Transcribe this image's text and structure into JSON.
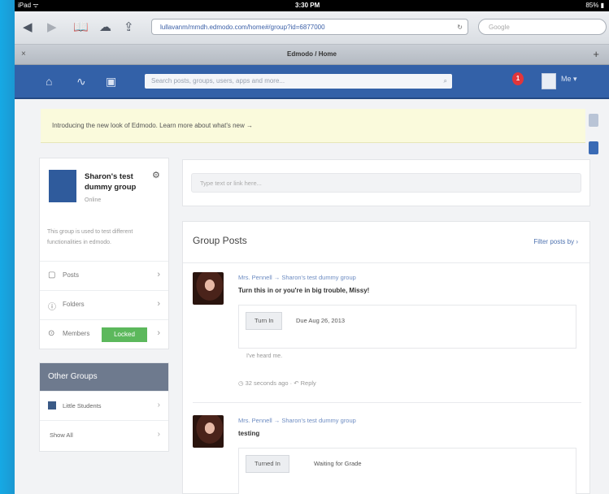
{
  "status": {
    "left": "iPad ᯤ",
    "time": "3:30 PM",
    "battery": "85% ▮"
  },
  "browser": {
    "url": "lullavanm/mmdh.edmodo.com/home#/group?id=6877000",
    "search_placeholder": "Google",
    "tab_title": "Edmodo / Home",
    "tab_close": "×",
    "tab_add": "+"
  },
  "appnav": {
    "search_placeholder": "Search posts, groups, users, apps and more...",
    "notif_count": "1",
    "me_label": "Me ▾"
  },
  "notice": {
    "text": "Introducing the new look of Edmodo. Learn more about what's new →",
    "close": "×"
  },
  "group": {
    "name": "Sharon's test dummy group",
    "subtitle": "Online",
    "description": "This group is used to test different functionalities in edmodo.",
    "rows": [
      {
        "icon": "folder-icon",
        "glyph": "▢",
        "label": "Posts",
        "arrow": "›"
      },
      {
        "icon": "info-icon",
        "glyph": "ⓘ",
        "label": "Folders",
        "arrow": "›"
      },
      {
        "icon": "members-icon",
        "glyph": "⊙",
        "label": "Members",
        "badge": "Locked",
        "arrow": "›"
      }
    ]
  },
  "other_groups": {
    "title": "Other Groups",
    "items": [
      {
        "label": "Little Students",
        "color": "#3a5a86",
        "arrow": "›"
      },
      {
        "label": "Show All",
        "arrow": "›"
      }
    ]
  },
  "post_box": {
    "placeholder": "Type text or link here..."
  },
  "posts": {
    "title": "Group Posts",
    "filter": "Filter posts by ›",
    "items": [
      {
        "author": "Mrs. Pennell → Sharon's test dummy group",
        "text": "Turn this in or you're in big trouble, Missy!",
        "button": "Turn In",
        "meta": "Due Aug 26, 2013",
        "reply": "I've heard me.",
        "foot": "◷ 32 seconds ago · ↶ Reply"
      },
      {
        "author": "Mrs. Pennell → Sharon's test dummy group",
        "text": "testing",
        "button": "Turned In",
        "meta": "Waiting for Grade",
        "reply": "",
        "foot": ""
      }
    ]
  },
  "colors": {
    "nav": "#3361a8",
    "locked": "#5cb85c",
    "notice": "#fafadc"
  }
}
